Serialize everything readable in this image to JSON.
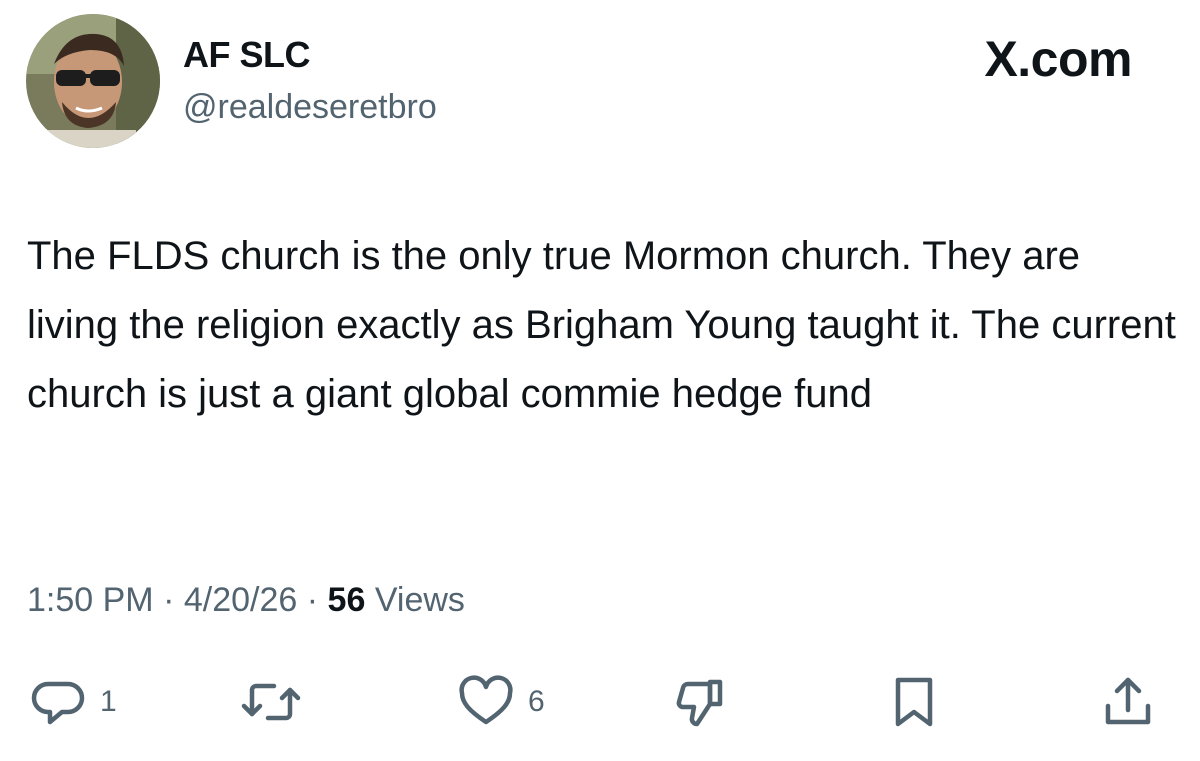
{
  "author": {
    "display_name": "AF SLC",
    "handle": "@realdeseretbro",
    "avatar_icon": "profile-photo-man-sunglasses"
  },
  "brand": {
    "label": "X.com"
  },
  "tweet": {
    "text": "The FLDS church is the only true Mormon church. They are living the religion exactly as Brigham Young taught it. The current church is just a giant global commie hedge fund"
  },
  "meta": {
    "time": "1:50 PM",
    "separator": "·",
    "date": "4/20/26",
    "views_count": "56",
    "views_label": "Views"
  },
  "actions": {
    "reply": {
      "icon": "reply-icon",
      "count": "1"
    },
    "retweet": {
      "icon": "retweet-icon"
    },
    "like": {
      "icon": "like-icon",
      "count": "6"
    },
    "dislike": {
      "icon": "dislike-icon"
    },
    "bookmark": {
      "icon": "bookmark-icon"
    },
    "share": {
      "icon": "share-icon"
    }
  },
  "colors": {
    "text_primary": "#0f1419",
    "text_secondary": "#536471",
    "background": "#ffffff"
  }
}
